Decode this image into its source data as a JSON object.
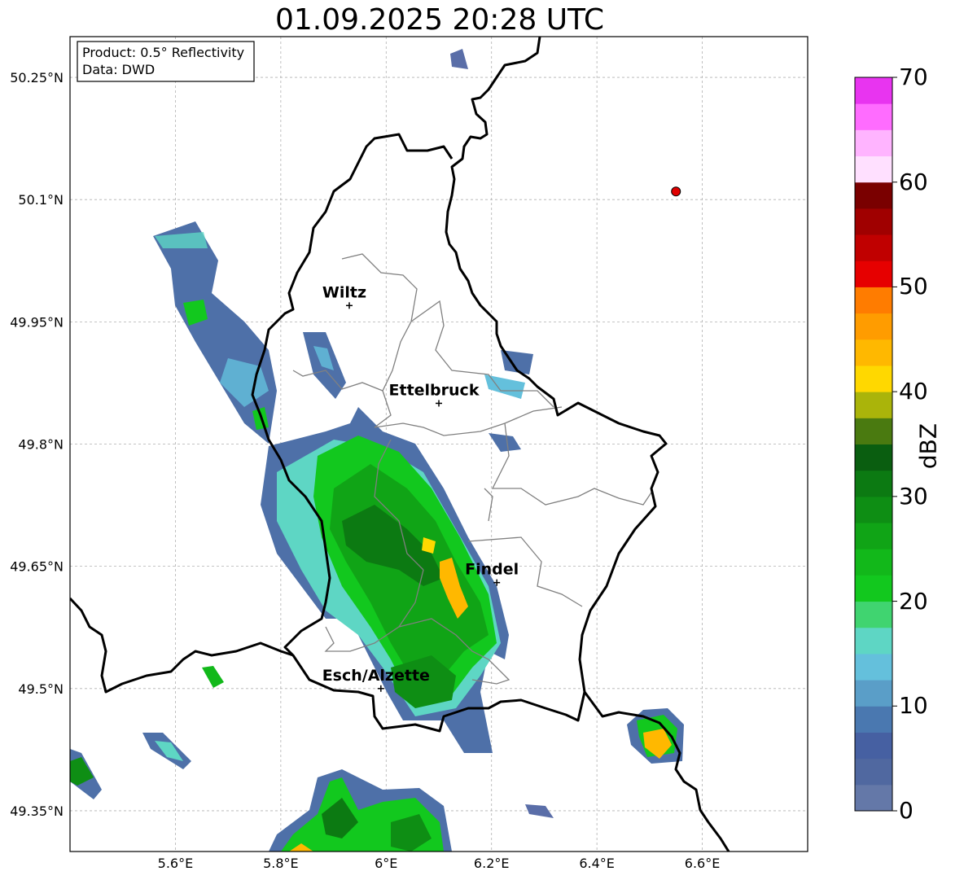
{
  "title": "01.09.2025 20:28 UTC",
  "info_box": {
    "product": "Product: 0.5° Reflectivity",
    "source": "Data: DWD"
  },
  "map": {
    "lon_range": [
      5.4,
      6.8
    ],
    "lat_range": [
      49.3,
      50.3
    ],
    "lat_ticks": [
      {
        "value": 50.25,
        "label": "50.25°N"
      },
      {
        "value": 50.1,
        "label": "50.1°N"
      },
      {
        "value": 49.95,
        "label": "49.95°N"
      },
      {
        "value": 49.8,
        "label": "49.8°N"
      },
      {
        "value": 49.65,
        "label": "49.65°N"
      },
      {
        "value": 49.5,
        "label": "49.5°N"
      },
      {
        "value": 49.35,
        "label": "49.35°N"
      }
    ],
    "lon_ticks": [
      {
        "value": 5.6,
        "label": "5.6°E"
      },
      {
        "value": 5.8,
        "label": "5.8°E"
      },
      {
        "value": 6.0,
        "label": "6°E"
      },
      {
        "value": 6.2,
        "label": "6.2°E"
      },
      {
        "value": 6.4,
        "label": "6.4°E"
      },
      {
        "value": 6.6,
        "label": "6.6°E"
      }
    ],
    "gridlines": true,
    "cities": [
      {
        "name": "Wiltz",
        "lon": 5.93,
        "lat": 49.97
      },
      {
        "name": "Ettelbruck",
        "lon": 6.1,
        "lat": 49.85
      },
      {
        "name": "Findel",
        "lon": 6.21,
        "lat": 49.63
      },
      {
        "name": "Esch/Alzette",
        "lon": 5.99,
        "lat": 49.5
      }
    ],
    "marker": {
      "lon": 6.55,
      "lat": 50.11,
      "color": "#e00000"
    }
  },
  "colorbar": {
    "label": "dBZ",
    "min": 0,
    "max": 70,
    "ticks": [
      {
        "value": 0,
        "label": "0"
      },
      {
        "value": 10,
        "label": "10"
      },
      {
        "value": 20,
        "label": "20"
      },
      {
        "value": 30,
        "label": "30"
      },
      {
        "value": 40,
        "label": "40"
      },
      {
        "value": 50,
        "label": "50"
      },
      {
        "value": 60,
        "label": "60"
      },
      {
        "value": 70,
        "label": "70"
      }
    ],
    "colors": [
      "#6478a8",
      "#5068a0",
      "#4660a2",
      "#4a78b0",
      "#5a9ec8",
      "#64c0dc",
      "#5ed6c4",
      "#40d470",
      "#12c81e",
      "#12b81a",
      "#10a416",
      "#0e8e14",
      "#0c7a12",
      "#0a5e10",
      "#4a7a10",
      "#aab40a",
      "#ffd800",
      "#ffb800",
      "#ff9c00",
      "#ff7c00",
      "#e60000",
      "#c00000",
      "#a00000",
      "#7a0000",
      "#ffe0ff",
      "#ffb4ff",
      "#ff6cff",
      "#e834f0"
    ]
  }
}
